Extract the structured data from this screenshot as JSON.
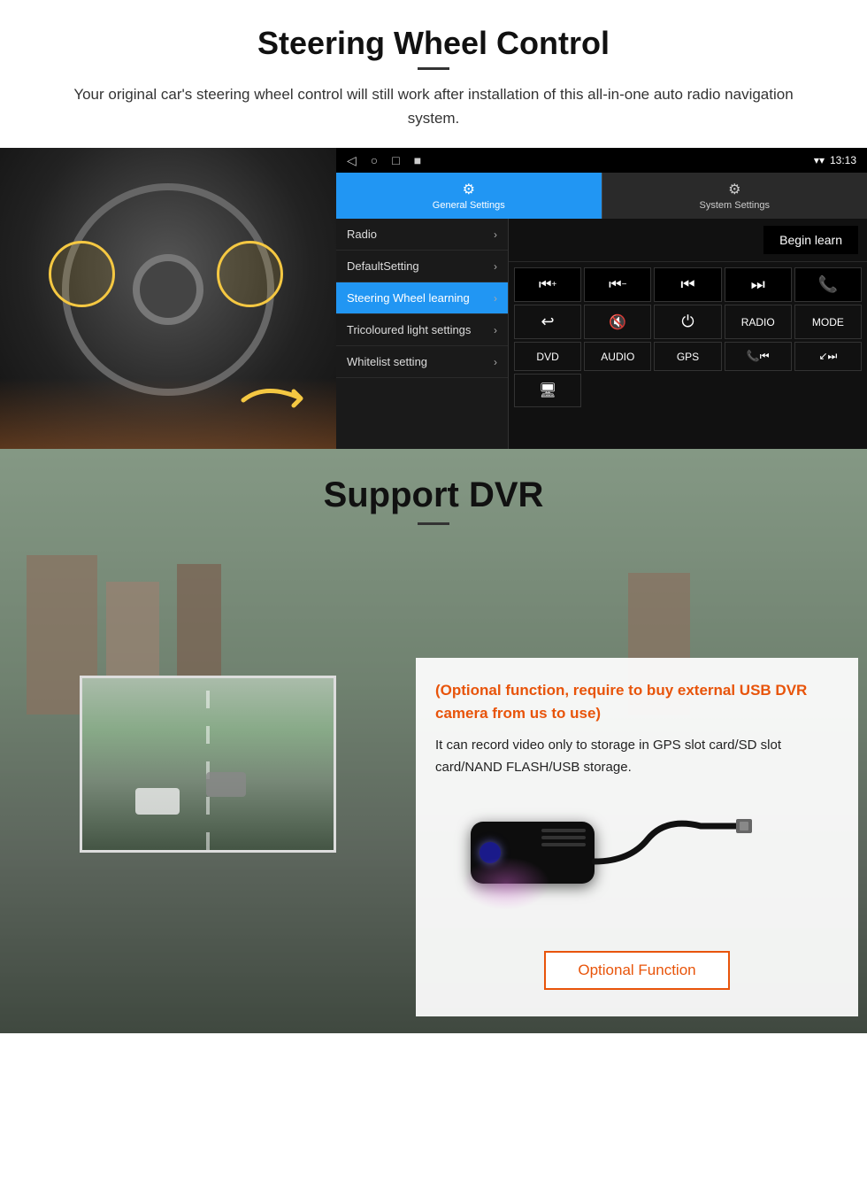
{
  "page": {
    "section1": {
      "title": "Steering Wheel Control",
      "subtitle": "Your original car's steering wheel control will still work after installation of this all-in-one auto radio navigation system.",
      "android_ui": {
        "status_bar": {
          "nav_icons": [
            "◁",
            "○",
            "□",
            "■"
          ],
          "time": "13:13",
          "signal_icon": "▼",
          "wifi_icon": "▲"
        },
        "tabs": [
          {
            "icon": "⚙",
            "label": "General Settings",
            "active": true
          },
          {
            "icon": "⚙",
            "label": "System Settings",
            "active": false
          }
        ],
        "menu_items": [
          {
            "label": "Radio",
            "active": false
          },
          {
            "label": "DefaultSetting",
            "active": false
          },
          {
            "label": "Steering Wheel learning",
            "active": true
          },
          {
            "label": "Tricoloured light settings",
            "active": false
          },
          {
            "label": "Whitelist setting",
            "active": false
          }
        ],
        "begin_learn_label": "Begin learn",
        "control_buttons": [
          "⏮+",
          "⏮−",
          "⏮⏮",
          "⏭⏭",
          "📞",
          "↩",
          "🔇",
          "⏻",
          "RADIO",
          "MODE",
          "DVD",
          "AUDIO",
          "GPS",
          "📞⏮",
          "↙⏭"
        ]
      }
    },
    "section2": {
      "title": "Support DVR",
      "optional_text": "(Optional function, require to buy external USB DVR camera from us to use)",
      "desc_text": "It can record video only to storage in GPS slot card/SD slot card/NAND FLASH/USB storage.",
      "optional_function_label": "Optional Function"
    }
  }
}
